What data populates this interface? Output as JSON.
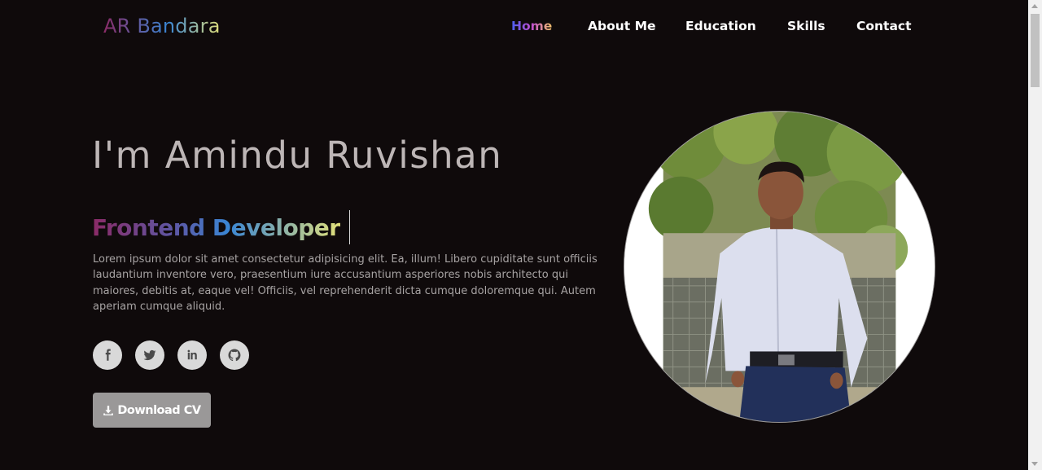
{
  "header": {
    "logo": "AR Bandara",
    "nav": [
      {
        "label": "Home",
        "active": true
      },
      {
        "label": "About Me",
        "active": false
      },
      {
        "label": "Education",
        "active": false
      },
      {
        "label": "Skills",
        "active": false
      },
      {
        "label": "Contact",
        "active": false
      }
    ]
  },
  "hero": {
    "title": "I'm Amindu Ruvishan",
    "role": "Frontend Developer",
    "bio": "Lorem ipsum dolor sit amet consectetur adipisicing elit. Ea, illum! Libero cupiditate sunt officiis laudantium inventore vero, praesentium iure accusantium asperiores nobis architecto qui maiores, debitis at, eaque vel! Officiis, vel reprehenderit dicta cumque doloremque qui. Autem aperiam cumque aliquid.",
    "socials": [
      {
        "icon": "facebook-icon"
      },
      {
        "icon": "twitter-icon"
      },
      {
        "icon": "linkedin-icon"
      },
      {
        "icon": "github-icon"
      }
    ],
    "download_label": "Download CV",
    "download_icon": "download-icon"
  },
  "profile_photo": {
    "icon": "profile-photo"
  },
  "colors": {
    "background": "#0f0a0b",
    "gradient_start": "#8b2a66",
    "gradient_mid": "#3a86d4",
    "gradient_end": "#e2e07a",
    "button_bg": "#9a9898",
    "social_bg": "#d9d9d9"
  }
}
